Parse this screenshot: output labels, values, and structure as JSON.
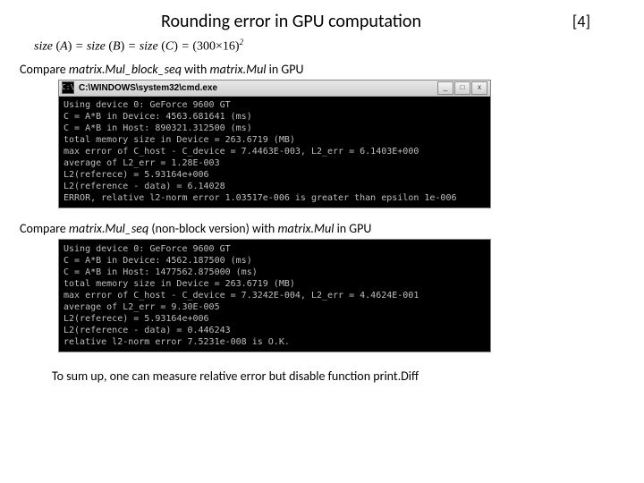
{
  "title": "Rounding error in GPU computation",
  "ref": "[4]",
  "formula_html": "size (A) = size (B) = size (C) = (300×16)²",
  "caption1_pre": "Compare ",
  "caption1_fn1": "matrix.Mul_block_seq",
  "caption1_mid": " with ",
  "caption1_fn2": "matrix.Mul",
  "caption1_post": " in GPU",
  "term1": {
    "title": "C:\\WINDOWS\\system32\\cmd.exe",
    "icon_glyph": "C:\\",
    "btn_min": "_",
    "btn_max": "□",
    "btn_close": "x",
    "lines": [
      "Using device 0: GeForce 9600 GT",
      "C = A*B in Device: 4563.681641 (ms)",
      "C = A*B in Host: 890321.312500 (ms)",
      "total memory size in Device = 263.6719 (MB)",
      "max error of C_host - C_device = 7.4463E-003, L2_err = 6.1403E+000",
      "average of L2_err = 1.28E-003",
      "L2(referece) = 5.93164e+006",
      "L2(reference - data) = 6.14028",
      "ERROR, relative l2-norm error 1.03517e-006 is greater than epsilon 1e-006"
    ]
  },
  "caption2_pre": "Compare ",
  "caption2_fn1": "matrix.Mul_seq",
  "caption2_mid1": " (non-block version) with ",
  "caption2_fn2": "matrix.Mul",
  "caption2_post": " in GPU",
  "term2": {
    "lines": [
      "Using device 0: GeForce 9600 GT",
      "C = A*B in Device: 4562.187500 (ms)",
      "C = A*B in Host: 1477562.875000 (ms)",
      "total memory size in Device = 263.6719 (MB)",
      "max error of C_host - C_device = 7.3242E-004, L2_err = 4.4624E-001",
      "average of L2_err = 9.30E-005",
      "L2(referece) = 5.93164e+006",
      "L2(reference - data) = 0.446243",
      "relative l2-norm error 7.5231e-008 is O.K."
    ]
  },
  "summary_pre": "To sum up, one can measure relative error but disable function ",
  "summary_fn": "print.Diff"
}
